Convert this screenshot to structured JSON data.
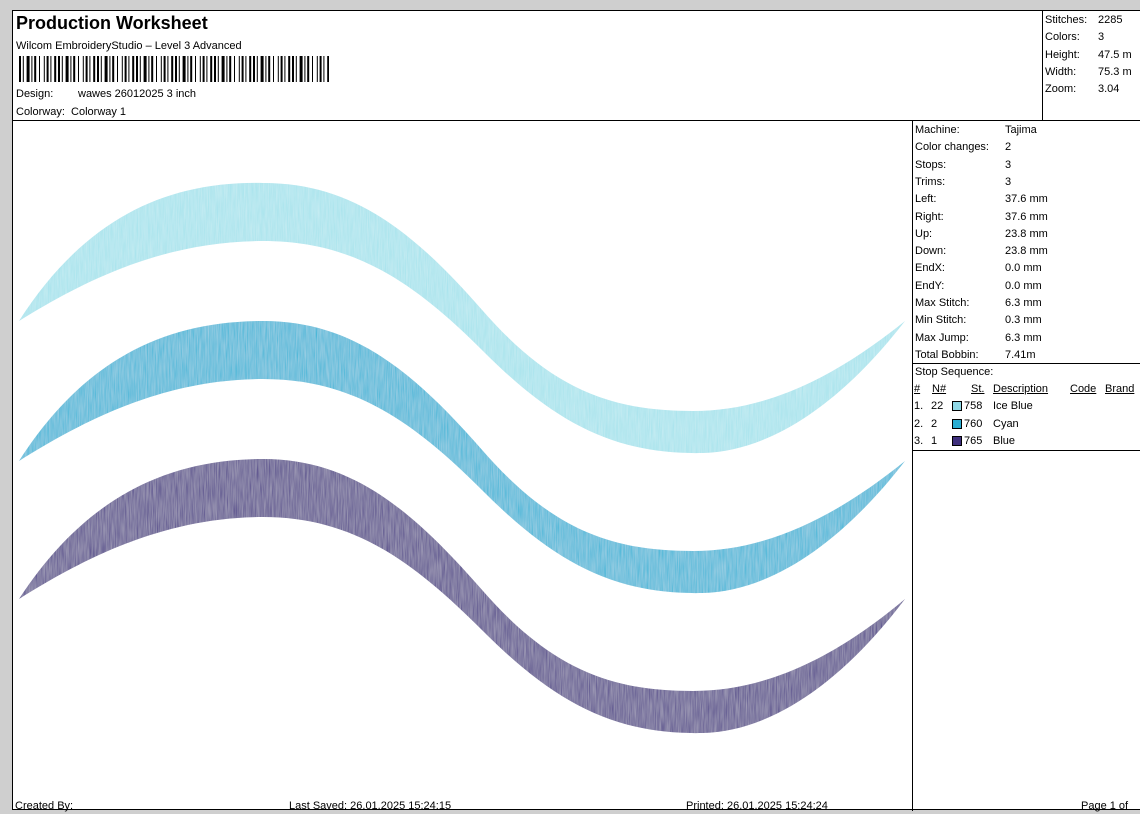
{
  "header": {
    "title": "Production Worksheet",
    "subtitle": "Wilcom EmbroideryStudio – Level 3 Advanced",
    "design_label": "Design:",
    "design_value": "wawes 26012025 3 inch",
    "colorway_label": "Colorway:",
    "colorway_value": "Colorway 1"
  },
  "summary": {
    "stitches_label": "Stitches:",
    "stitches": "2285",
    "colors_label": "Colors:",
    "colors": "3",
    "height_label": "Height:",
    "height": "47.5 m",
    "width_label": "Width:",
    "width": "75.3 m",
    "zoom_label": "Zoom:",
    "zoom": "3.04"
  },
  "machine_info": [
    {
      "label": "Machine:",
      "value": "Tajima"
    },
    {
      "label": "Color changes:",
      "value": "2"
    },
    {
      "label": "Stops:",
      "value": "3"
    },
    {
      "label": "Trims:",
      "value": "3"
    },
    {
      "label": "Left:",
      "value": "37.6 mm"
    },
    {
      "label": "Right:",
      "value": "37.6 mm"
    },
    {
      "label": "Up:",
      "value": "23.8 mm"
    },
    {
      "label": "Down:",
      "value": "23.8 mm"
    },
    {
      "label": "EndX:",
      "value": "0.0 mm"
    },
    {
      "label": "EndY:",
      "value": "0.0 mm"
    },
    {
      "label": "Max Stitch:",
      "value": "6.3 mm"
    },
    {
      "label": "Min Stitch:",
      "value": "0.3 mm"
    },
    {
      "label": "Max Jump:",
      "value": "6.3 mm"
    },
    {
      "label": "Total Bobbin:",
      "value": "7.41m"
    }
  ],
  "stop_sequence": {
    "label": "Stop Sequence:",
    "columns": [
      "#",
      "N#",
      "St.",
      "Description",
      "Code",
      "Brand"
    ],
    "rows": [
      {
        "num": "1.",
        "n": "22",
        "st": "758",
        "desc": "Ice Blue",
        "color": "#8fd8e6"
      },
      {
        "num": "2.",
        "n": "2",
        "st": "760",
        "desc": "Cyan",
        "color": "#2aaed3"
      },
      {
        "num": "3.",
        "n": "1",
        "st": "765",
        "desc": "Blue",
        "color": "#3e2f7c"
      }
    ]
  },
  "design_colors": {
    "ice_blue": "#a2e2ec",
    "cyan": "#2db3d6",
    "blue": "#463785"
  },
  "footer": {
    "created": "Created By:",
    "saved": "Last Saved: 26.01.2025 15:24:15",
    "printed": "Printed: 26.01.2025 15:24:24",
    "page": "Page 1 of"
  }
}
